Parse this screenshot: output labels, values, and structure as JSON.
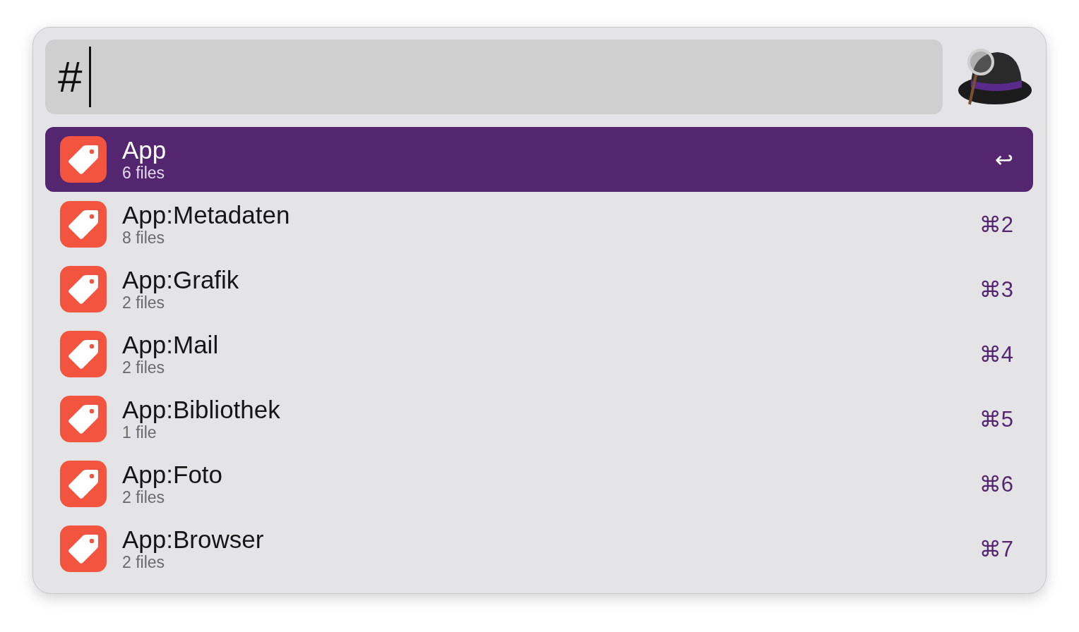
{
  "search": {
    "value": "#"
  },
  "results": [
    {
      "title": "App",
      "subtitle": "6 files",
      "shortcut": "↩",
      "selected": true
    },
    {
      "title": "App:Metadaten",
      "subtitle": "8 files",
      "shortcut": "⌘2",
      "selected": false
    },
    {
      "title": "App:Grafik",
      "subtitle": "2 files",
      "shortcut": "⌘3",
      "selected": false
    },
    {
      "title": "App:Mail",
      "subtitle": "2 files",
      "shortcut": "⌘4",
      "selected": false
    },
    {
      "title": "App:Bibliothek",
      "subtitle": "1 file",
      "shortcut": "⌘5",
      "selected": false
    },
    {
      "title": "App:Foto",
      "subtitle": "2 files",
      "shortcut": "⌘6",
      "selected": false
    },
    {
      "title": "App:Browser",
      "subtitle": "2 files",
      "shortcut": "⌘7",
      "selected": false
    }
  ]
}
